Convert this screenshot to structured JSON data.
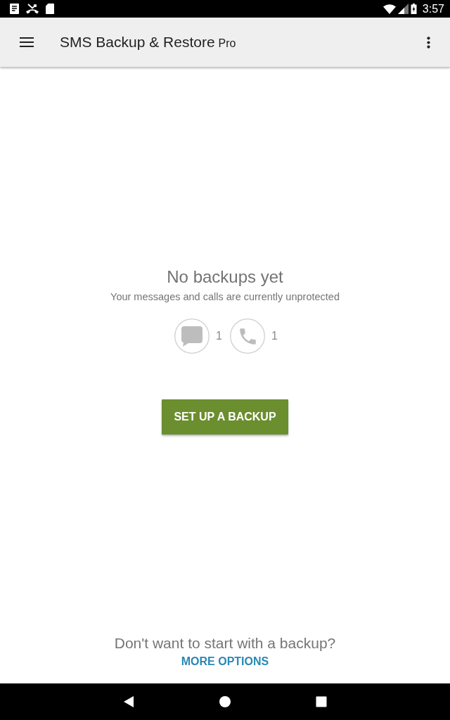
{
  "status_bar": {
    "time": "3:57"
  },
  "app_bar": {
    "title": "SMS Backup & Restore",
    "edition": "Pro"
  },
  "empty_state": {
    "title": "No backups yet",
    "subtitle": "Your messages and calls are currently unprotected",
    "counts": [
      {
        "kind": "messages",
        "count": "1"
      },
      {
        "kind": "calls",
        "count": "1"
      }
    ],
    "button": "SET UP A BACKUP"
  },
  "footer": {
    "prompt": "Don't want to start with a backup?",
    "link": "MORE OPTIONS"
  }
}
